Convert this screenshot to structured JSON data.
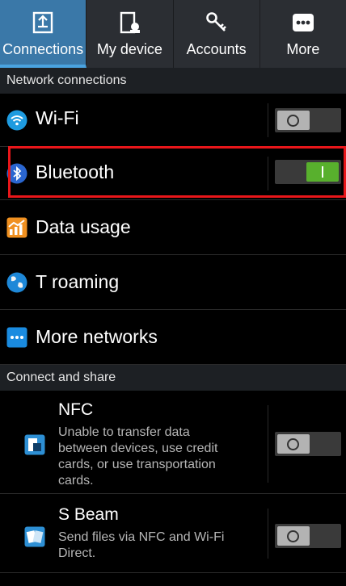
{
  "tabs": [
    {
      "label": "Connections",
      "icon": "connections-icon",
      "active": true
    },
    {
      "label": "My device",
      "icon": "my-device-icon",
      "active": false
    },
    {
      "label": "Accounts",
      "icon": "accounts-key-icon",
      "active": false
    },
    {
      "label": "More",
      "icon": "more-icon",
      "active": false
    }
  ],
  "sections": {
    "network": "Network connections",
    "connect_share": "Connect and share"
  },
  "network_items": [
    {
      "label": "Wi-Fi",
      "icon": "wifi-icon",
      "toggle": "off"
    },
    {
      "label": "Bluetooth",
      "icon": "bluetooth-icon",
      "toggle": "on"
    },
    {
      "label": "Data usage",
      "icon": "data-usage-icon"
    },
    {
      "label": "T roaming",
      "icon": "globe-icon"
    },
    {
      "label": "More networks",
      "icon": "more-networks-icon"
    }
  ],
  "share_items": [
    {
      "label": "NFC",
      "icon": "nfc-icon",
      "description": [
        "Unable to transfer data",
        "between devices, use credit",
        "cards, or use transportation",
        "cards."
      ],
      "toggle": "off"
    },
    {
      "label": "S Beam",
      "icon": "s-beam-icon",
      "description": [
        "Send files via NFC and Wi-Fi",
        "Direct."
      ],
      "toggle": "off"
    }
  ],
  "colors": {
    "active_tab": "#3a78a8",
    "toggle_on": "#58b02d",
    "highlight": "#e8161a"
  }
}
